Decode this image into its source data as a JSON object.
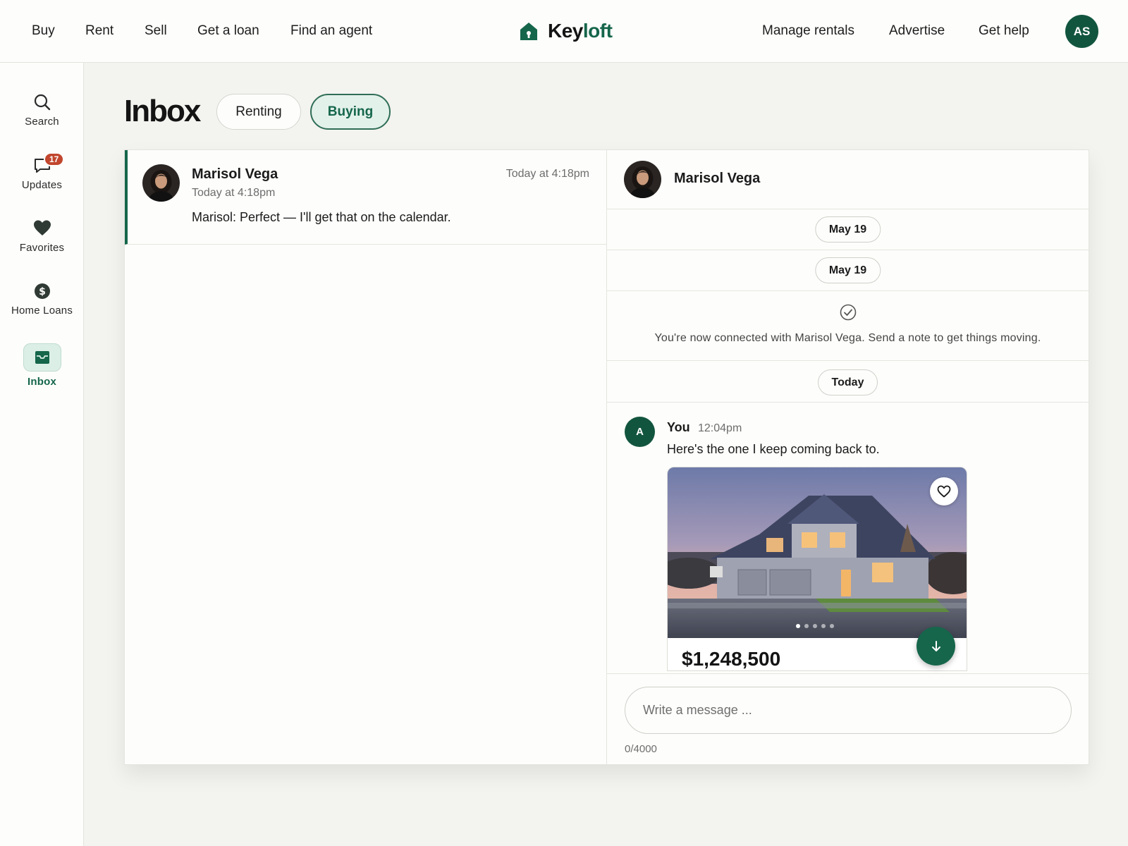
{
  "topnav": {
    "left_links": [
      "Buy",
      "Rent",
      "Sell",
      "Get a loan",
      "Find an agent"
    ],
    "brand": {
      "name_part1": "Key",
      "name_part2": "loft",
      "icon": "house-icon"
    },
    "right_links": [
      "Manage rentals",
      "Advertise",
      "Get help"
    ],
    "user_initials": "AS"
  },
  "sidebar": {
    "items": [
      {
        "label": "Search",
        "icon": "search-icon"
      },
      {
        "label": "Updates",
        "icon": "chat-bubble-icon",
        "badge": "17"
      },
      {
        "label": "Favorites",
        "icon": "heart-icon"
      },
      {
        "label": "Home Loans",
        "icon": "dollar-icon"
      },
      {
        "label": "Inbox",
        "icon": "inbox-tray-icon",
        "active": true
      }
    ]
  },
  "inbox": {
    "title": "Inbox",
    "tabs": [
      {
        "label": "Renting",
        "active": false
      },
      {
        "label": "Buying",
        "active": true
      }
    ]
  },
  "conversations": [
    {
      "name": "Marisol Vega",
      "subtitle": "Today at 4:18pm",
      "time": "Today at 4:18pm",
      "preview": "Marisol: Perfect — I'll get that on the calendar."
    }
  ],
  "chat": {
    "contact_name": "Marisol Vega",
    "date_separators": [
      "May 19",
      "May 19"
    ],
    "connected_message": "You're now connected with Marisol Vega. Send a note to get things moving.",
    "today_label": "Today",
    "message": {
      "avatar_initial": "A",
      "author": "You",
      "time": "12:04pm",
      "text": "Here's the one I keep coming back to."
    },
    "listing": {
      "price": "$1,248,500",
      "photo_count": 5,
      "current_photo": 1
    },
    "composer": {
      "placeholder": "Write a message ...",
      "char_count": "0/4000"
    }
  },
  "colors": {
    "brand_green": "#15664b",
    "badge_red": "#c1462d",
    "active_tab_bg": "#e3f1eb"
  }
}
